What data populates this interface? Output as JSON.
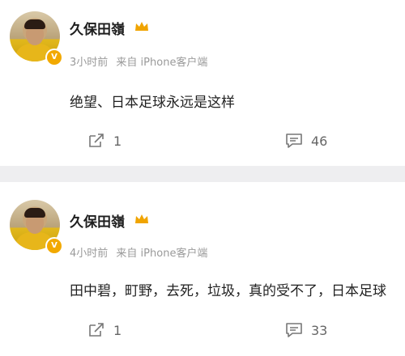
{
  "posts": [
    {
      "username": "久保田嶺",
      "time": "3小时前",
      "source": "来自 iPhone客户端",
      "content": "绝望、日本足球永远是这样",
      "reposts": "1",
      "comments": "46"
    },
    {
      "username": "久保田嶺",
      "time": "4小时前",
      "source": "来自 iPhone客户端",
      "content": "田中碧，町野，去死，垃圾，真的受不了，日本足球",
      "reposts": "1",
      "comments": "33"
    }
  ],
  "icons": {
    "verified_badge": "verified-v-icon",
    "crown": "crown-icon",
    "repost": "repost-icon",
    "comment": "comment-icon"
  },
  "colors": {
    "badge": "#f2a900",
    "meta_text": "#9a9a9a",
    "divider": "#eeeef0"
  }
}
